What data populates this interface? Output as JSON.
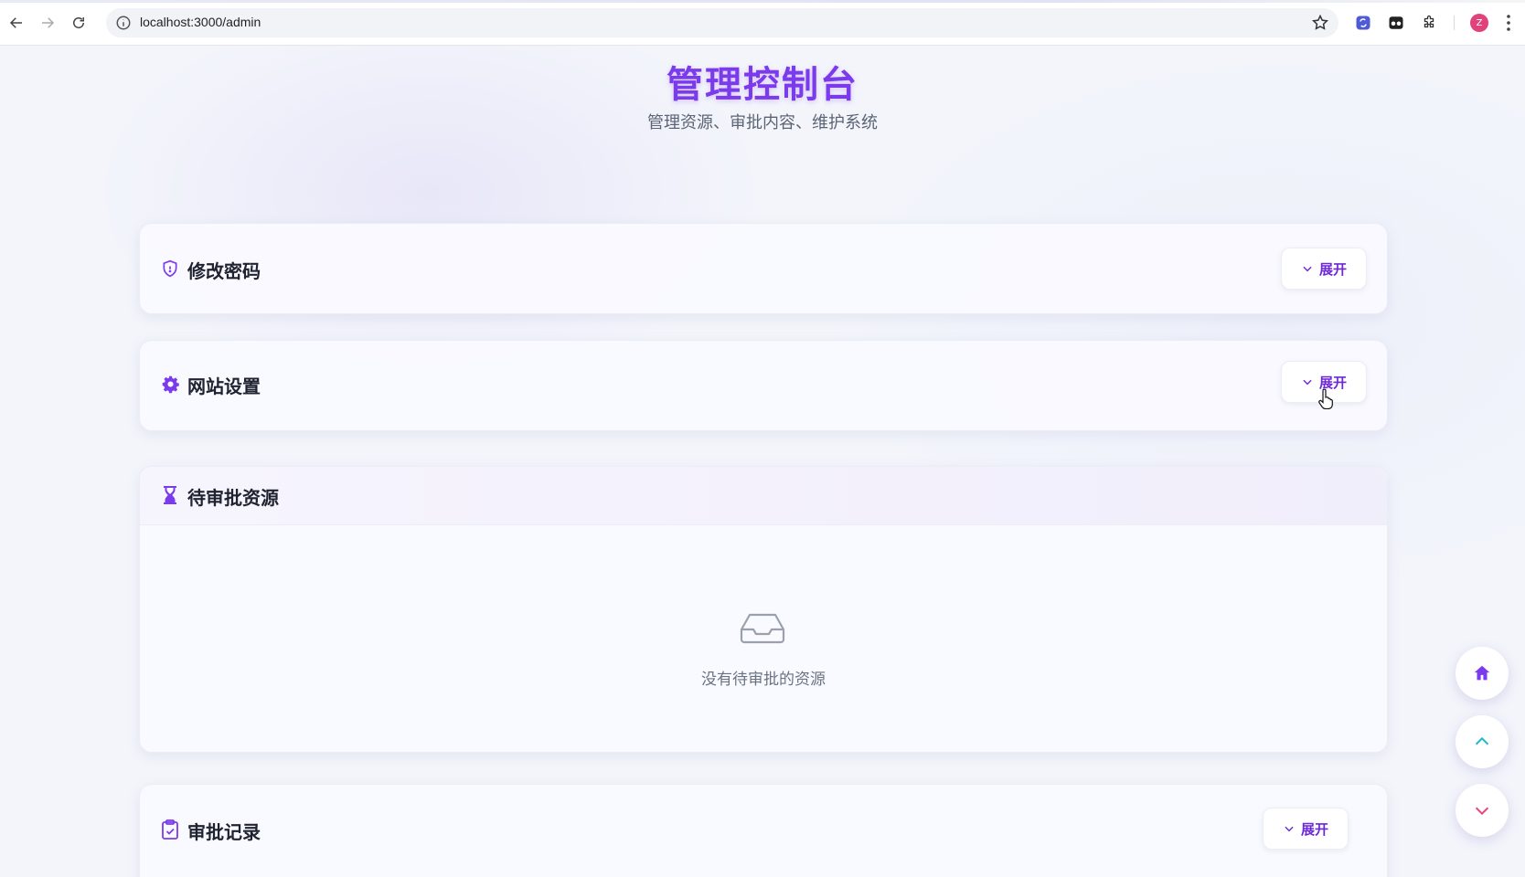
{
  "browser": {
    "url": "localhost:3000/admin",
    "profile_initial": "Z"
  },
  "header": {
    "title": "管理控制台",
    "subtitle": "管理资源、审批内容、维护系统"
  },
  "sections": {
    "password": {
      "title": "修改密码",
      "icon": "shield-icon",
      "expand_label": "展开"
    },
    "site_settings": {
      "title": "网站设置",
      "icon": "gear-icon",
      "expand_label": "展开"
    },
    "pending": {
      "title": "待审批资源",
      "icon": "hourglass-icon",
      "empty_text": "没有待审批的资源"
    },
    "records": {
      "title": "审批记录",
      "icon": "clipboard-check-icon",
      "expand_label": "展开"
    }
  },
  "floating_buttons": [
    {
      "name": "home",
      "icon": "home-icon"
    },
    {
      "name": "scroll-up",
      "icon": "chevron-up-icon"
    },
    {
      "name": "scroll-down",
      "icon": "chevron-down-icon"
    }
  ],
  "colors": {
    "accent": "#7c3aed",
    "text": "#1f2330",
    "muted": "#6b7280",
    "up_arrow": "#22b8c9",
    "down_arrow": "#e8467c"
  }
}
